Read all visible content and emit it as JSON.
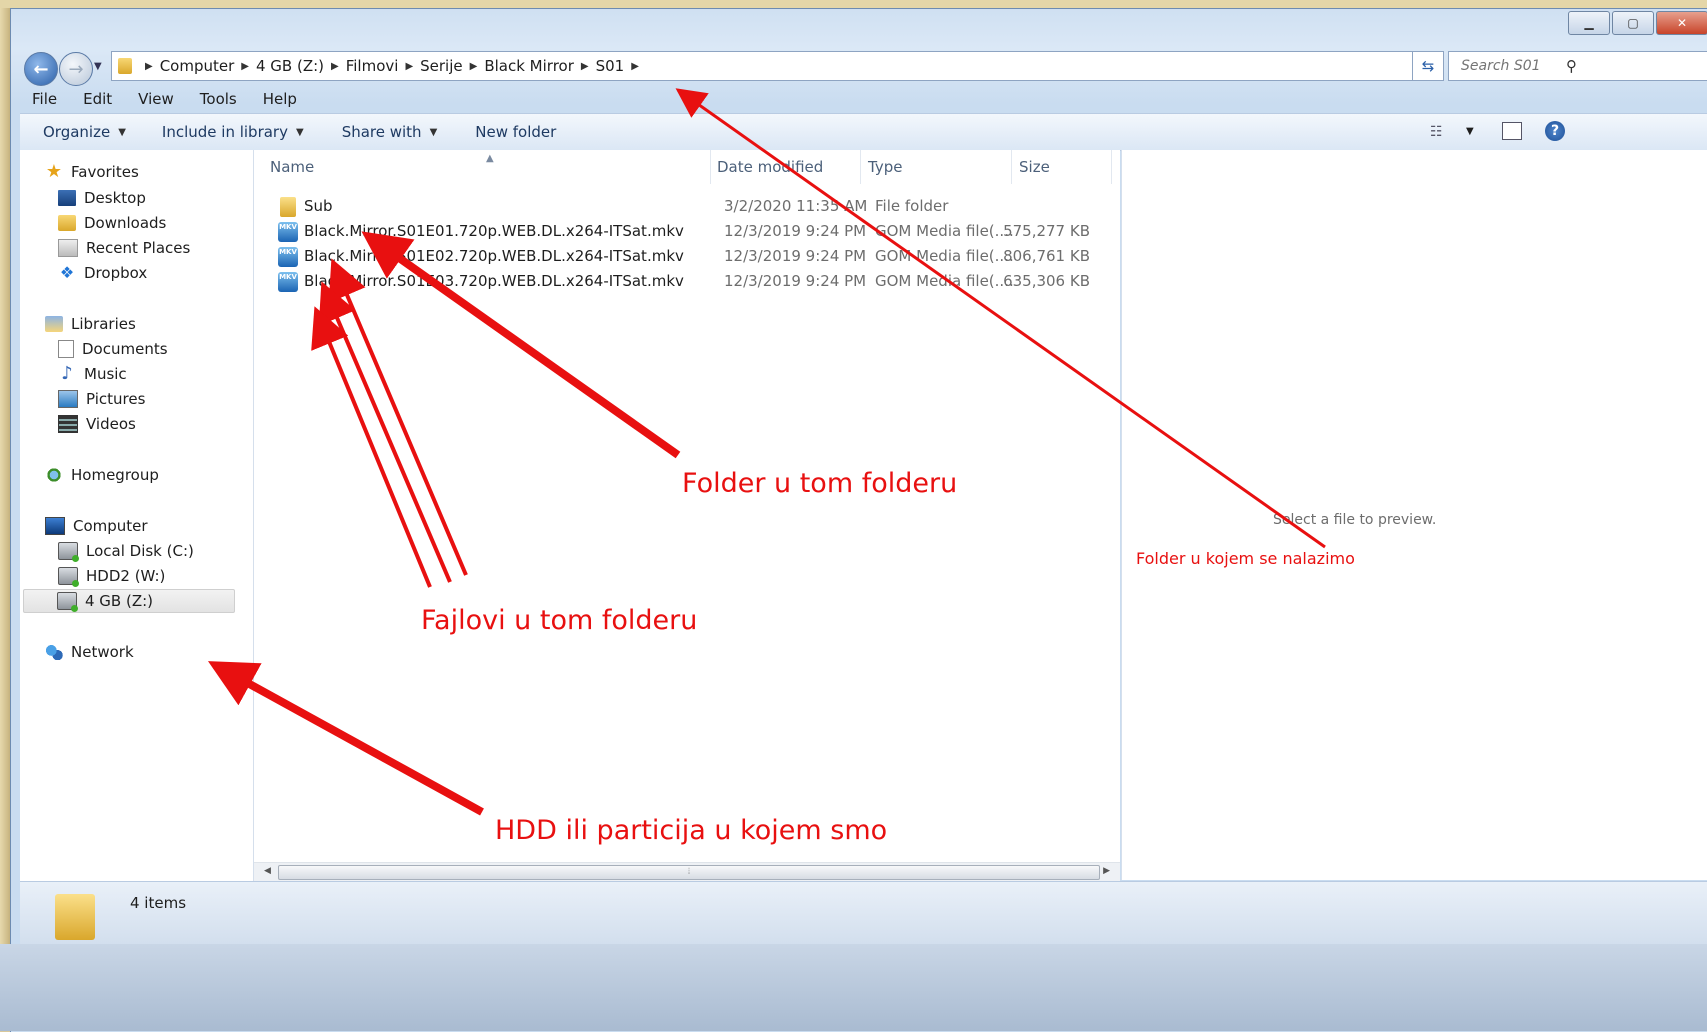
{
  "address": {
    "crumbs": [
      "Computer",
      "4 GB (Z:)",
      "Filmovi",
      "Serije",
      "Black Mirror",
      "S01"
    ],
    "search_placeholder": "Search S01"
  },
  "menu": [
    "File",
    "Edit",
    "View",
    "Tools",
    "Help"
  ],
  "commands": {
    "organize": "Organize",
    "include": "Include in library",
    "share": "Share with",
    "new_folder": "New folder"
  },
  "sidebar": {
    "favorites": {
      "label": "Favorites",
      "items": [
        "Desktop",
        "Downloads",
        "Recent Places",
        "Dropbox"
      ]
    },
    "libraries": {
      "label": "Libraries",
      "items": [
        "Documents",
        "Music",
        "Pictures",
        "Videos"
      ]
    },
    "homegroup": "Homegroup",
    "computer": {
      "label": "Computer",
      "items": [
        "Local Disk (C:)",
        "HDD2 (W:)",
        "4 GB  (Z:)"
      ]
    },
    "network": "Network"
  },
  "columns": {
    "name": "Name",
    "date": "Date modified",
    "type": "Type",
    "size": "Size"
  },
  "files": [
    {
      "name": "Sub",
      "date": "3/2/2020 11:35 AM",
      "type": "File folder",
      "size": "",
      "icon": "folder-icon"
    },
    {
      "name": "Black.Mirror.S01E01.720p.WEB.DL.x264-ITSat.mkv",
      "date": "12/3/2019 9:24 PM",
      "type": "GOM Media file(....",
      "size": "575,277 KB",
      "icon": "mkv-file-icon"
    },
    {
      "name": "Black.Mirror.S01E02.720p.WEB.DL.x264-ITSat.mkv",
      "date": "12/3/2019 9:24 PM",
      "type": "GOM Media file(....",
      "size": "806,761 KB",
      "icon": "mkv-file-icon"
    },
    {
      "name": "Black.Mirror.S01E03.720p.WEB.DL.x264-ITSat.mkv",
      "date": "12/3/2019 9:24 PM",
      "type": "GOM Media file(....",
      "size": "635,306 KB",
      "icon": "mkv-file-icon"
    }
  ],
  "preview": {
    "text": "Select a file to preview."
  },
  "status": {
    "items": "4 items"
  },
  "annotations": {
    "folder_in_folder": "Folder u tom folderu",
    "files_in_folder": "Fajlovi u tom folderu",
    "current_folder": "Folder u kojem se nalazimo",
    "drive": "HDD ili particija u kojem smo",
    "color": "#e81010"
  }
}
